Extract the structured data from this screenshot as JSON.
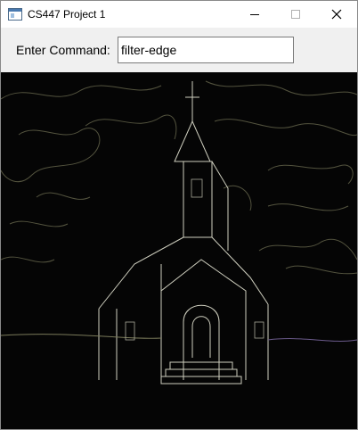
{
  "window": {
    "title": "CS447 Project 1",
    "icons": {
      "app": "app-window-icon",
      "minimize": "minimize-icon",
      "maximize": "maximize-icon",
      "close": "close-icon"
    }
  },
  "toolbar": {
    "command_label": "Enter Command:",
    "command_value": "filter-edge"
  },
  "canvas": {
    "description_icon": "edge-filtered-church-image",
    "colors": {
      "background": "#050505",
      "edge": "#c8c8b4",
      "sky_edge": "#8a8a6a",
      "accent": "#5a3a8a"
    }
  }
}
